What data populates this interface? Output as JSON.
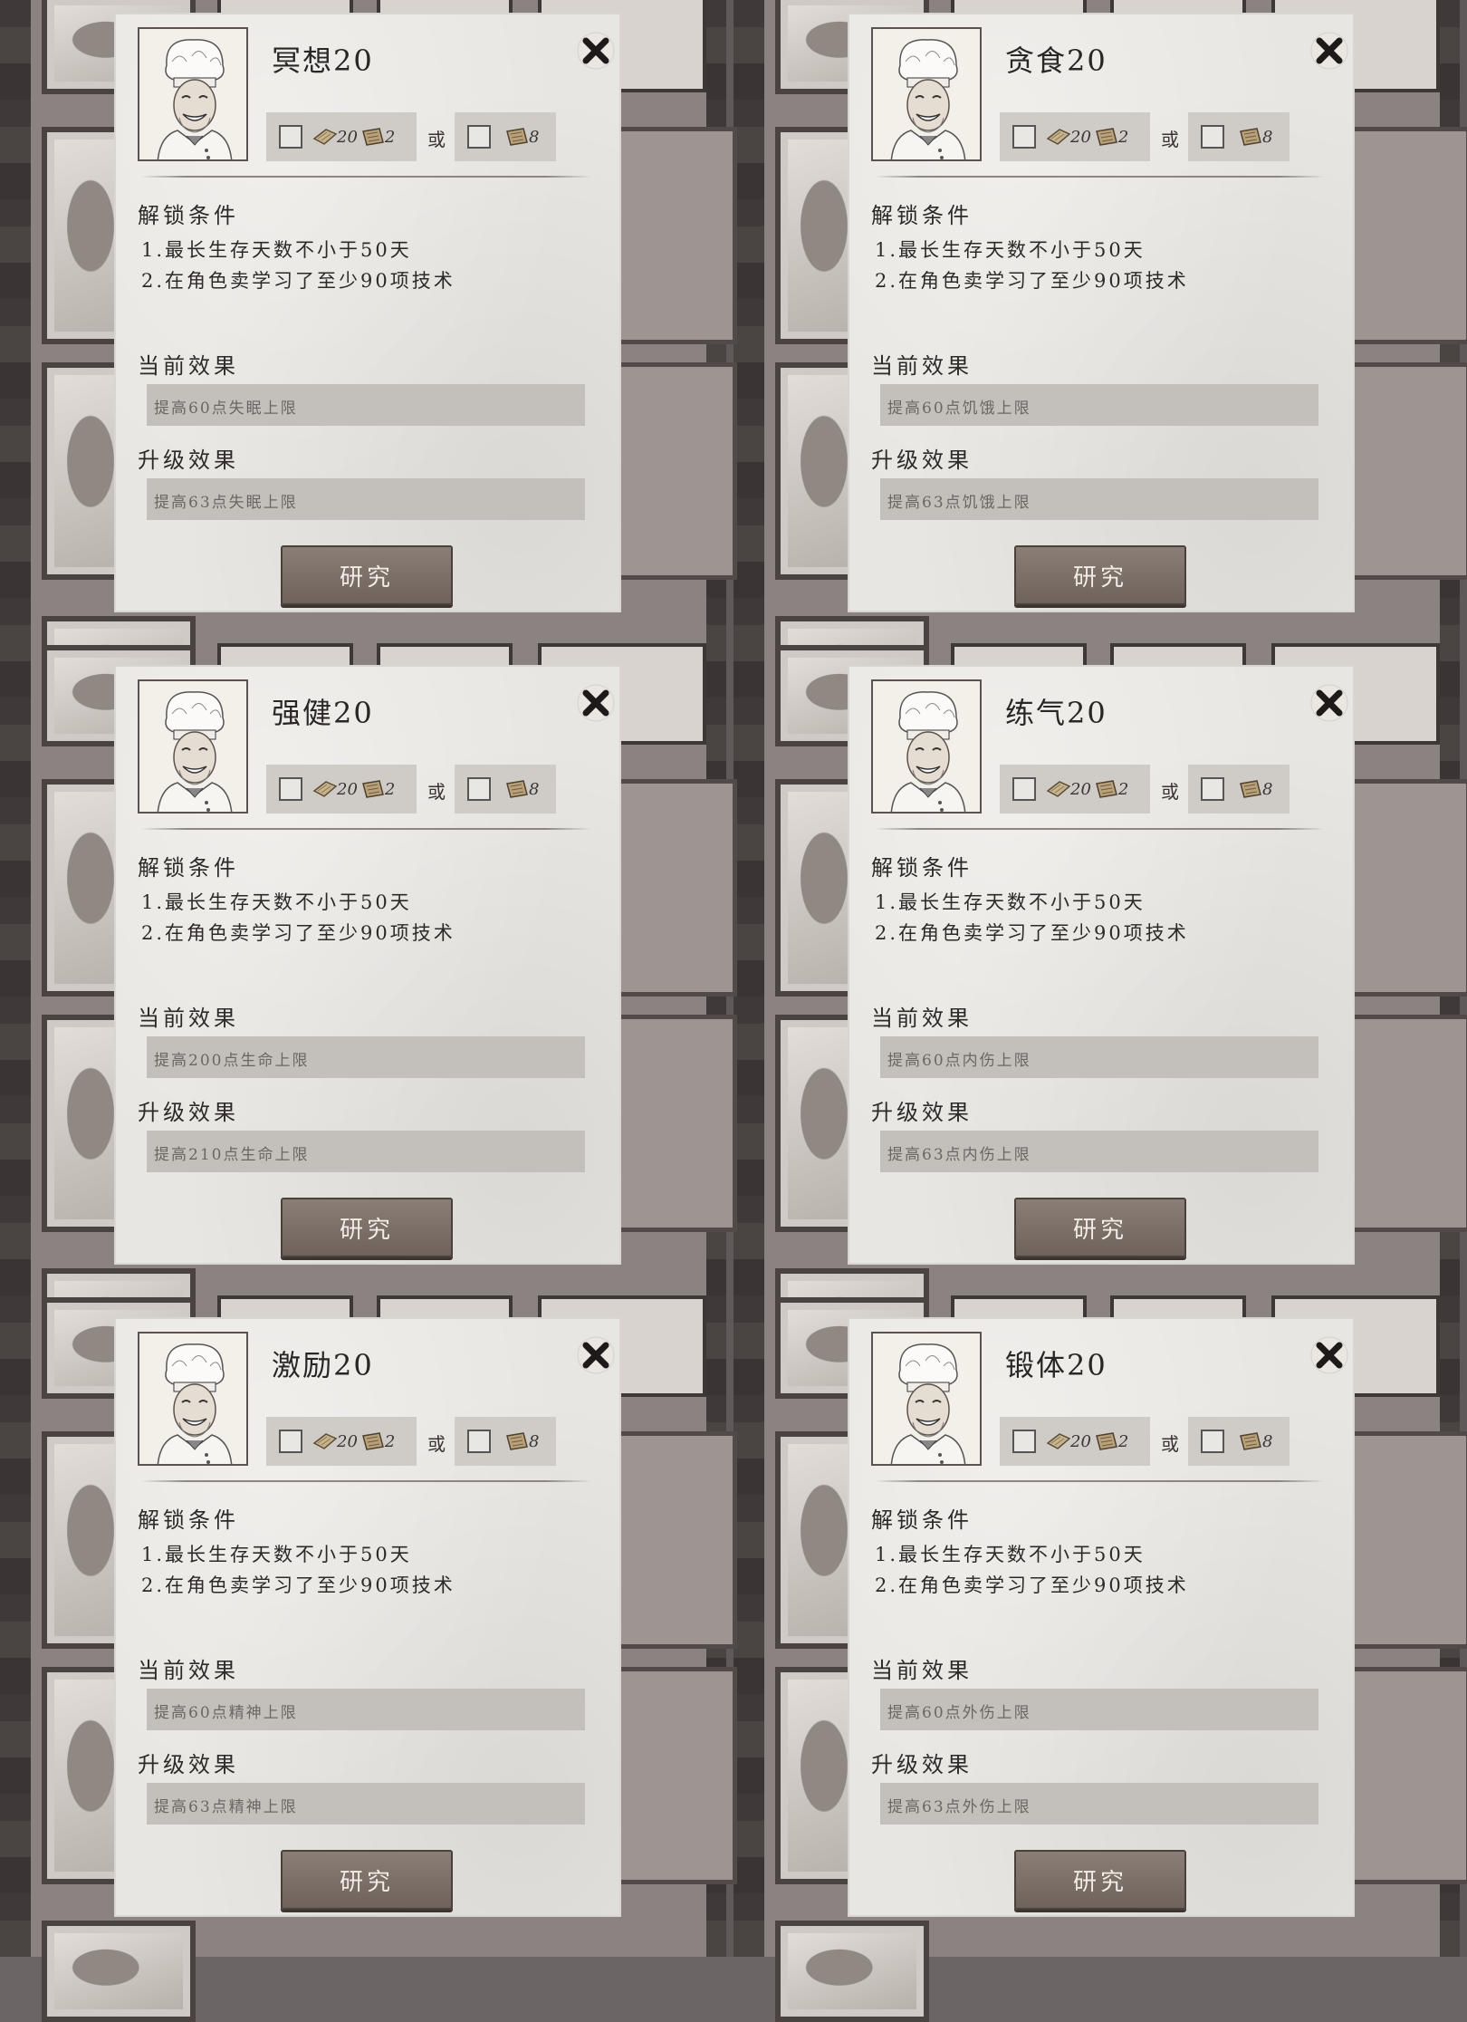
{
  "panels": [
    {
      "title": "冥想20",
      "cost": {
        "item_a_qty": "20",
        "item_b_qty": "2",
        "or": "或",
        "item_c_qty": "8"
      },
      "unlock_label": "解锁条件",
      "conditions": [
        "1.最长生存天数不小于50天",
        "2.在角色卖学习了至少90项技术"
      ],
      "current_label": "当前效果",
      "current_effect": "提高60点失眠上限",
      "upgrade_label": "升级效果",
      "upgrade_effect": "提高63点失眠上限",
      "research_label": "研究"
    },
    {
      "title": "贪食20",
      "cost": {
        "item_a_qty": "20",
        "item_b_qty": "2",
        "or": "或",
        "item_c_qty": "8"
      },
      "unlock_label": "解锁条件",
      "conditions": [
        "1.最长生存天数不小于50天",
        "2.在角色卖学习了至少90项技术"
      ],
      "current_label": "当前效果",
      "current_effect": "提高60点饥饿上限",
      "upgrade_label": "升级效果",
      "upgrade_effect": "提高63点饥饿上限",
      "research_label": "研究"
    },
    {
      "title": "强健20",
      "cost": {
        "item_a_qty": "20",
        "item_b_qty": "2",
        "or": "或",
        "item_c_qty": "8"
      },
      "unlock_label": "解锁条件",
      "conditions": [
        "1.最长生存天数不小于50天",
        "2.在角色卖学习了至少90项技术"
      ],
      "current_label": "当前效果",
      "current_effect": "提高200点生命上限",
      "upgrade_label": "升级效果",
      "upgrade_effect": "提高210点生命上限",
      "research_label": "研究"
    },
    {
      "title": "练气20",
      "cost": {
        "item_a_qty": "20",
        "item_b_qty": "2",
        "or": "或",
        "item_c_qty": "8"
      },
      "unlock_label": "解锁条件",
      "conditions": [
        "1.最长生存天数不小于50天",
        "2.在角色卖学习了至少90项技术"
      ],
      "current_label": "当前效果",
      "current_effect": "提高60点内伤上限",
      "upgrade_label": "升级效果",
      "upgrade_effect": "提高63点内伤上限",
      "research_label": "研究"
    },
    {
      "title": "激励20",
      "cost": {
        "item_a_qty": "20",
        "item_b_qty": "2",
        "or": "或",
        "item_c_qty": "8"
      },
      "unlock_label": "解锁条件",
      "conditions": [
        "1.最长生存天数不小于50天",
        "2.在角色卖学习了至少90项技术"
      ],
      "current_label": "当前效果",
      "current_effect": "提高60点精神上限",
      "upgrade_label": "升级效果",
      "upgrade_effect": "提高63点精神上限",
      "research_label": "研究"
    },
    {
      "title": "锻体20",
      "cost": {
        "item_a_qty": "20",
        "item_b_qty": "2",
        "or": "或",
        "item_c_qty": "8"
      },
      "unlock_label": "解锁条件",
      "conditions": [
        "1.最长生存天数不小于50天",
        "2.在角色卖学习了至少90项技术"
      ],
      "current_label": "当前效果",
      "current_effect": "提高60点外伤上限",
      "upgrade_label": "升级效果",
      "upgrade_effect": "提高63点外伤上限",
      "research_label": "研究"
    }
  ],
  "icons": {
    "close": "close-x-icon",
    "portrait": "chef-portrait",
    "item_a": "wood-plank-icon",
    "item_b": "scroll-icon",
    "item_c": "scroll-icon",
    "chevron": "chevron-down-icon"
  },
  "colors": {
    "panel": "#e8e6e2",
    "button": "#7a6e67",
    "effect_bar": "#c3c0bc"
  }
}
